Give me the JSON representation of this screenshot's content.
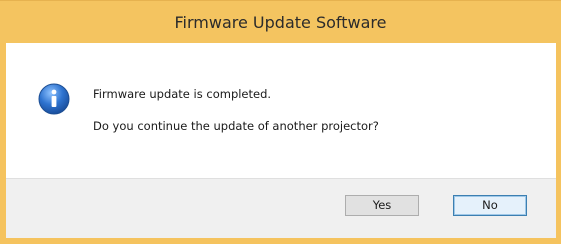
{
  "window": {
    "title": "Firmware Update Software"
  },
  "message": {
    "line1": "Firmware update is completed.",
    "line2": "Do you continue the update of another projector?"
  },
  "icon": {
    "name": "info-icon",
    "color": "#2a6fc9"
  },
  "buttons": {
    "yes_label": "Yes",
    "no_label": "No"
  },
  "colors": {
    "accent_frame": "#f5c35e",
    "footer_bg": "#f0f0f0",
    "default_button_border": "#3c7fb1"
  }
}
